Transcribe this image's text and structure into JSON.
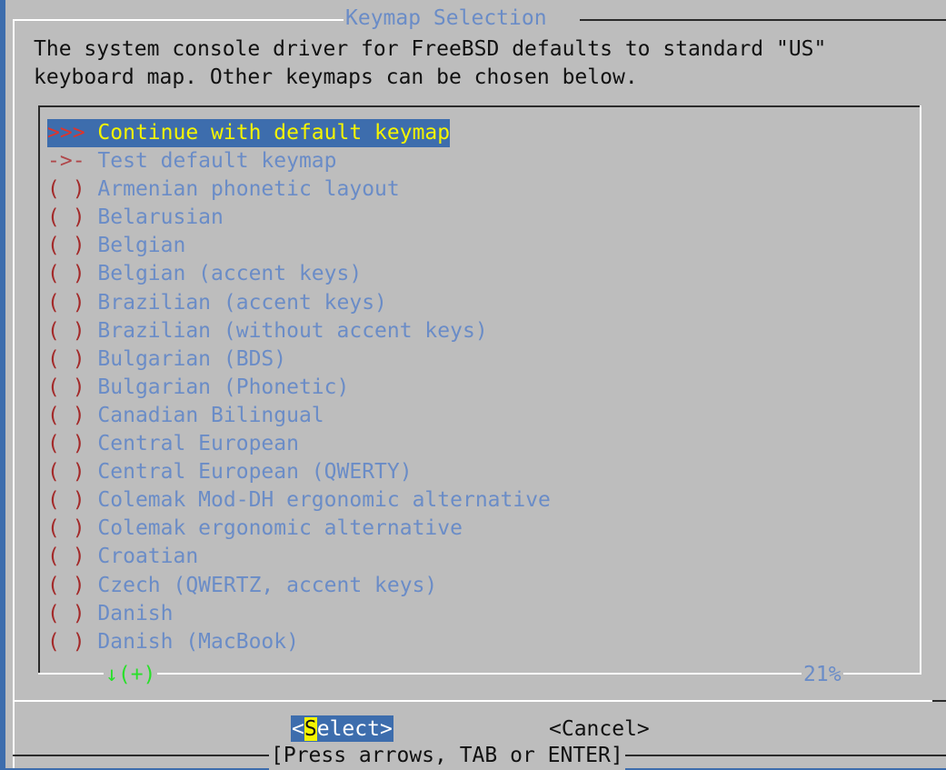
{
  "dialog": {
    "title": "Keymap Selection",
    "description_line1": "The system console driver for FreeBSD defaults to standard \"US\"",
    "description_line2": "keyboard map. Other keymaps can be chosen below."
  },
  "list": {
    "items": [
      {
        "mark": ">>>",
        "label": "Continue with default keymap",
        "selected": true
      },
      {
        "mark": "->-",
        "label": "Test default keymap"
      },
      {
        "mark": "( )",
        "label": "Armenian phonetic layout"
      },
      {
        "mark": "( )",
        "label": "Belarusian"
      },
      {
        "mark": "( )",
        "label": "Belgian"
      },
      {
        "mark": "( )",
        "label": "Belgian (accent keys)"
      },
      {
        "mark": "( )",
        "label": "Brazilian (accent keys)"
      },
      {
        "mark": "( )",
        "label": "Brazilian (without accent keys)"
      },
      {
        "mark": "( )",
        "label": "Bulgarian (BDS)"
      },
      {
        "mark": "( )",
        "label": "Bulgarian (Phonetic)"
      },
      {
        "mark": "( )",
        "label": "Canadian Bilingual"
      },
      {
        "mark": "( )",
        "label": "Central European"
      },
      {
        "mark": "( )",
        "label": "Central European (QWERTY)"
      },
      {
        "mark": "( )",
        "label": "Colemak Mod-DH ergonomic alternative"
      },
      {
        "mark": "( )",
        "label": "Colemak ergonomic alternative"
      },
      {
        "mark": "( )",
        "label": "Croatian"
      },
      {
        "mark": "( )",
        "label": "Czech (QWERTZ, accent keys)"
      },
      {
        "mark": "( )",
        "label": "Danish"
      },
      {
        "mark": "( )",
        "label": "Danish (MacBook)"
      }
    ],
    "scroll_indicator": "↓(+)",
    "scroll_percent": "21%"
  },
  "buttons": {
    "select_open": "<",
    "select_hotkey": "S",
    "select_rest": "elect>",
    "cancel": "<Cancel>"
  },
  "hint": "[Press arrows, TAB or ENTER]",
  "colors": {
    "background": "#3d6dad",
    "dialog": "#bdbdbd",
    "title": "#6a8cc7",
    "highlight_text": "#f4f400",
    "scroll_indicator": "#29e02a"
  }
}
